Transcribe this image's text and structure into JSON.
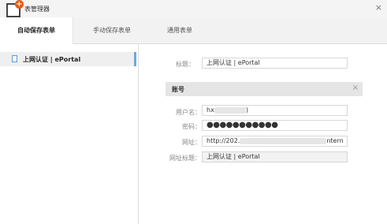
{
  "window": {
    "title": "表管理器",
    "close_symbol": "×",
    "logo_symbol": "+"
  },
  "tabs": [
    {
      "label": "自动保存表单"
    },
    {
      "label": "手动保存表单"
    },
    {
      "label": "通用表单"
    }
  ],
  "sidebar": {
    "items": [
      {
        "label": "上网认证 | ePortal"
      }
    ]
  },
  "form": {
    "title_label": "标题：",
    "title_value": "上网认证 | ePortal",
    "section_title": "账号",
    "section_close": "×",
    "username_label": "用户名：",
    "username_value": "hx",
    "username_suffix": ")",
    "password_label": "密码：",
    "password_value": "●●●●●●●●●●●",
    "url_label": "网址：",
    "url_prefix": "http://202.",
    "url_suffix": "ntern",
    "url_title_label": "网址标题：",
    "url_title_value": "上网认证 | ePortal"
  }
}
